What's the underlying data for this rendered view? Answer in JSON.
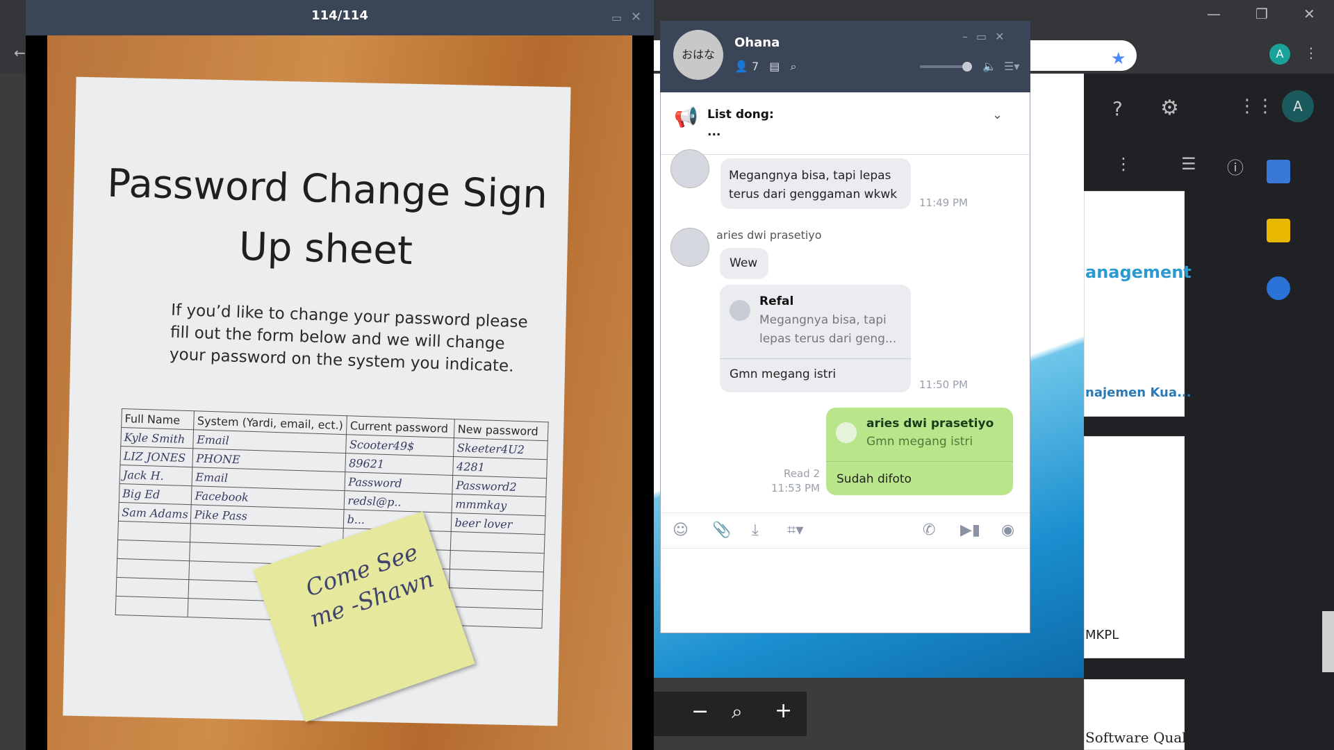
{
  "viewer": {
    "counter": "114/114",
    "photo_text": {
      "title": "Password Change Sign Up sheet",
      "body": "If you’d like to change your password please fill out the form below and we will change your password on the system you indicate.",
      "columns": [
        "Full Name",
        "System (Yardi, email, ect.)",
        "Current password",
        "New password"
      ],
      "rows": [
        [
          "Kyle Smith",
          "Email",
          "Scooter49$",
          "Skeeter4U2"
        ],
        [
          "LIZ JONES",
          "PHONE",
          "89621",
          "4281"
        ],
        [
          "Jack H.",
          "Email",
          "Password",
          "Password2"
        ],
        [
          "Big Ed",
          "Facebook",
          "redsl@p..",
          "mmmkay"
        ],
        [
          "Sam Adams",
          "Pike Pass",
          "b...",
          "beer lover"
        ]
      ],
      "sticky_note": "Come See me -Shawn"
    }
  },
  "chat": {
    "group_avatar": "おはな",
    "group_name": "Ohana",
    "member_count": "7",
    "notice_title": "List dong:",
    "notice_body": "...",
    "messages": [
      {
        "text": "Megangnya bisa, tapi lepas terus dari genggaman wkwk",
        "time": "11:49 PM"
      },
      {
        "sender": "aries dwi prasetiyo",
        "text": "Wew"
      },
      {
        "quote_name": "Refal",
        "quote_text": "Megangnya bisa, tapi lepas terus dari geng...",
        "text": "Gmn megang istri",
        "time": "11:50 PM"
      },
      {
        "quote_name": "aries dwi prasetiyo",
        "quote_text": "Gmn megang istri",
        "text": "Sudah difoto",
        "read": "Read 2",
        "time": "11:53 PM"
      }
    ]
  },
  "bg": {
    "heading": "anagement",
    "card_link": "najemen Kua...",
    "card_label": "MKPL",
    "bottom_text": "Software Qualit",
    "avatar_letter": "A"
  },
  "zoom": {
    "minus": "−",
    "plus": "+"
  }
}
